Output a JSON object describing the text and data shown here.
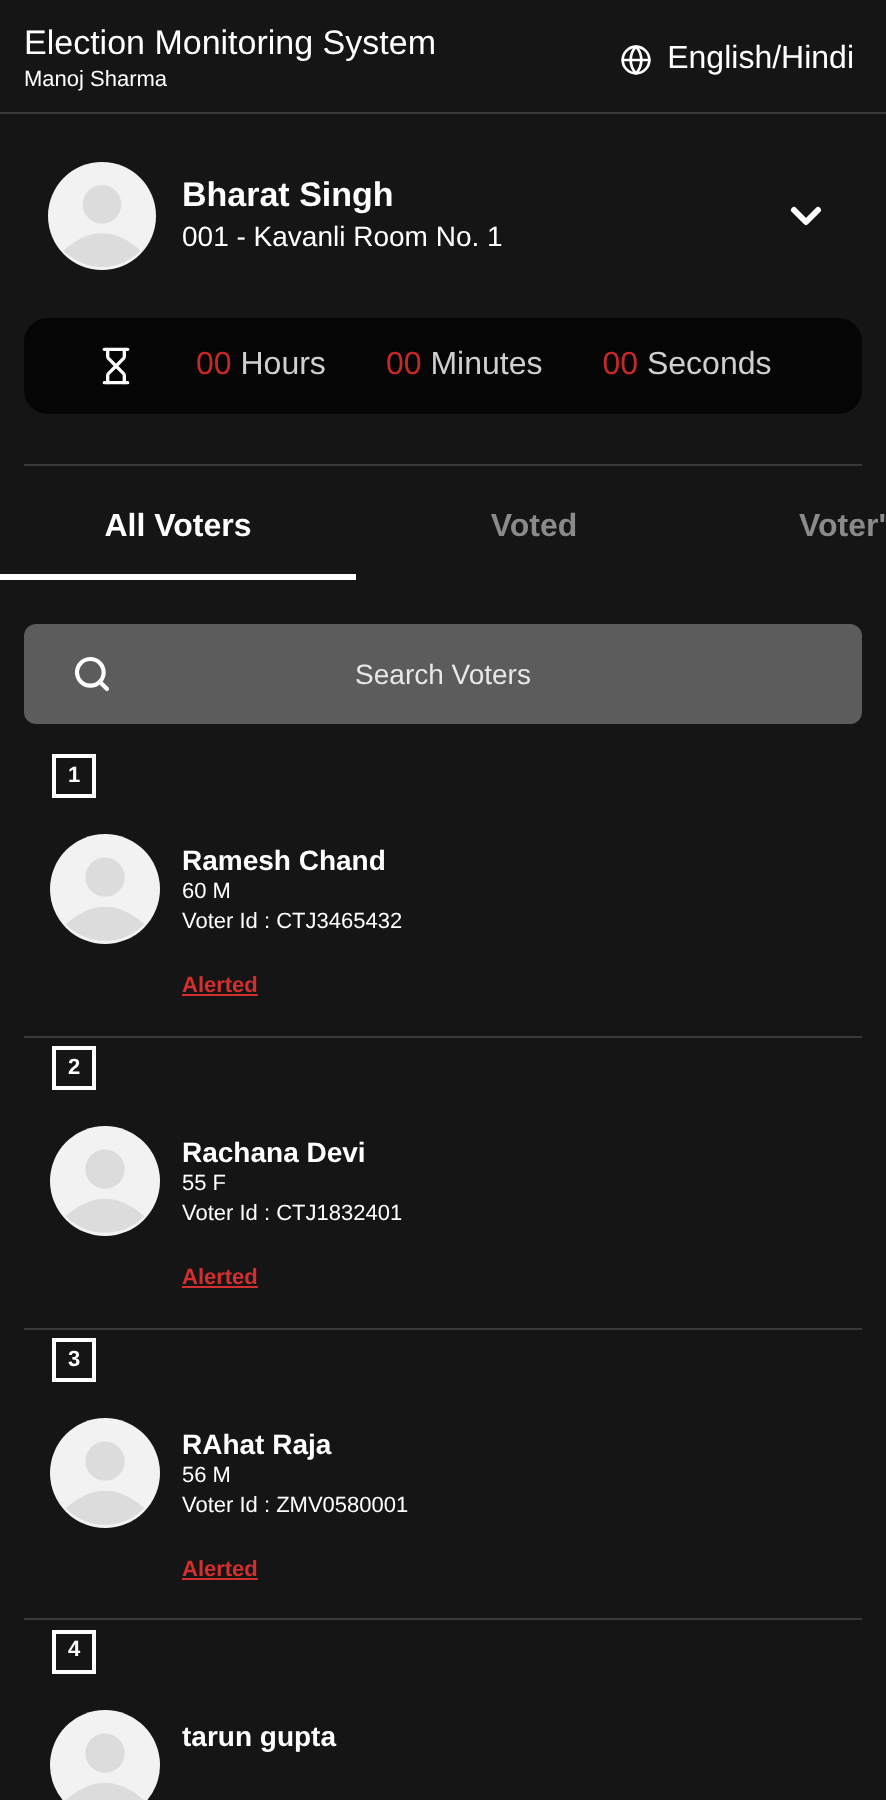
{
  "header": {
    "title": "Election Monitoring System",
    "subtitle": "Manoj Sharma",
    "language": "English/Hindi"
  },
  "officer": {
    "name": "Bharat Singh",
    "booth": "001 - Kavanli Room No. 1",
    "expanded": false
  },
  "timer": [
    {
      "value": "00",
      "unit": "Hours"
    },
    {
      "value": "00",
      "unit": "Minutes"
    },
    {
      "value": "00",
      "unit": "Seconds"
    }
  ],
  "tabs": [
    {
      "label": "All Voters",
      "selected": true
    },
    {
      "label": "Voted",
      "selected": false
    },
    {
      "label": "Voter'",
      "selected": false
    }
  ],
  "search": {
    "placeholder": "Search Voters"
  },
  "voters": [
    {
      "number": "1",
      "name": "Ramesh Chand",
      "age_gender": "60 M",
      "voter_id": "Voter Id : CTJ3465432",
      "status": "Alerted"
    },
    {
      "number": "2",
      "name": "Rachana Devi",
      "age_gender": "55 F",
      "voter_id": "Voter Id : CTJ1832401",
      "status": "Alerted"
    },
    {
      "number": "3",
      "name": "RAhat Raja",
      "age_gender": "56 M",
      "voter_id": "Voter Id : ZMV0580001",
      "status": "Alerted"
    },
    {
      "number": "4",
      "name": "tarun gupta"
    }
  ]
}
